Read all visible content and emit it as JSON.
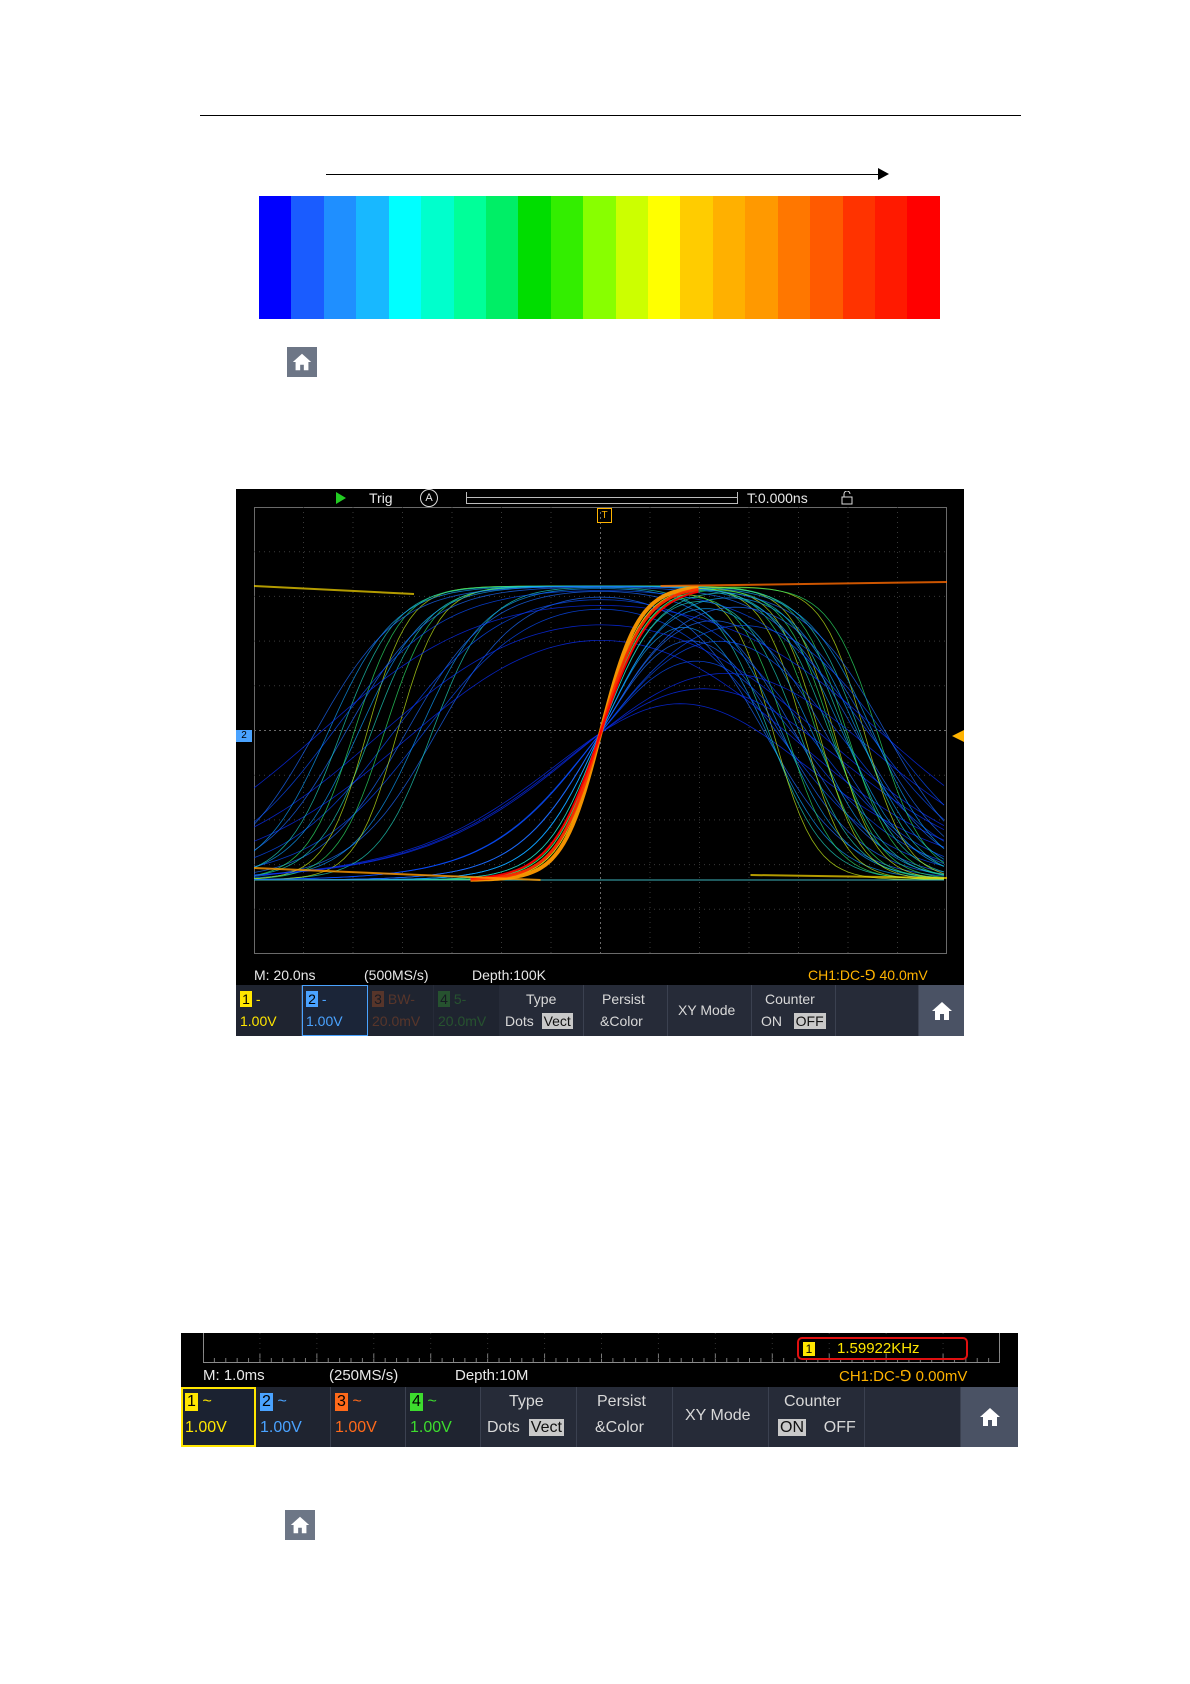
{
  "colorbar": {
    "colors": [
      "#0000ff",
      "#1a5cff",
      "#1f8fff",
      "#18b8ff",
      "#00ffff",
      "#00ffcc",
      "#00ff99",
      "#00ee66",
      "#00dd00",
      "#33ee00",
      "#88ff00",
      "#ccff00",
      "#ffff00",
      "#ffcc00",
      "#ffb000",
      "#ff9900",
      "#ff7700",
      "#ff5a00",
      "#ff3300",
      "#ff1a00",
      "#ff0000"
    ]
  },
  "scope1": {
    "top": {
      "trig_label": "Trig",
      "auto_symbol": "A",
      "time_offset": "T:0.000ns",
      "trigger_marker": "T",
      "ch2_marker": "2"
    },
    "status": {
      "timebase": "M: 20.0ns",
      "sample_rate": "(500MS/s)",
      "depth": "Depth:100K",
      "trigger": "CH1:DC-⅁ 40.0mV"
    },
    "menu": {
      "ch1": {
        "num": "1",
        "coupling": "-",
        "scale": "1.00V"
      },
      "ch2": {
        "num": "2",
        "coupling": "-",
        "scale": "1.00V"
      },
      "ch3": {
        "num": "3",
        "coupling": "BW-",
        "scale": "20.0mV"
      },
      "ch4": {
        "num": "4",
        "coupling": "5-",
        "scale": "20.0mV"
      },
      "type": {
        "label": "Type",
        "opt_a": "Dots",
        "opt_b": "Vect"
      },
      "persist": {
        "l1": "Persist",
        "l2": "&Color"
      },
      "xy": {
        "label": "XY Mode"
      },
      "counter": {
        "label": "Counter",
        "on": "ON",
        "off": "OFF"
      }
    }
  },
  "scope2": {
    "counter_channel": "1",
    "frequency": "1.59922KHz",
    "status": {
      "timebase": "M: 1.0ms",
      "sample_rate": "(250MS/s)",
      "depth": "Depth:10M",
      "trigger": "CH1:DC-⅁ 0.00mV"
    },
    "menu": {
      "ch1": {
        "num": "1",
        "coupling": "~",
        "scale": "1.00V"
      },
      "ch2": {
        "num": "2",
        "coupling": "~",
        "scale": "1.00V"
      },
      "ch3": {
        "num": "3",
        "coupling": "~",
        "scale": "1.00V"
      },
      "ch4": {
        "num": "4",
        "coupling": "~",
        "scale": "1.00V"
      },
      "type": {
        "label": "Type",
        "opt_a": "Dots",
        "opt_b": "Vect"
      },
      "persist": {
        "l1": "Persist",
        "l2": "&Color"
      },
      "xy": {
        "label": "XY Mode"
      },
      "counter": {
        "label": "Counter",
        "on": "ON",
        "off": "OFF"
      }
    }
  },
  "colors": {
    "ch1": "#ffe600",
    "ch2": "#4aa3ff",
    "ch3": "#ff6a1a",
    "ch4": "#3ddc2e",
    "trigger": "#ffb300"
  }
}
